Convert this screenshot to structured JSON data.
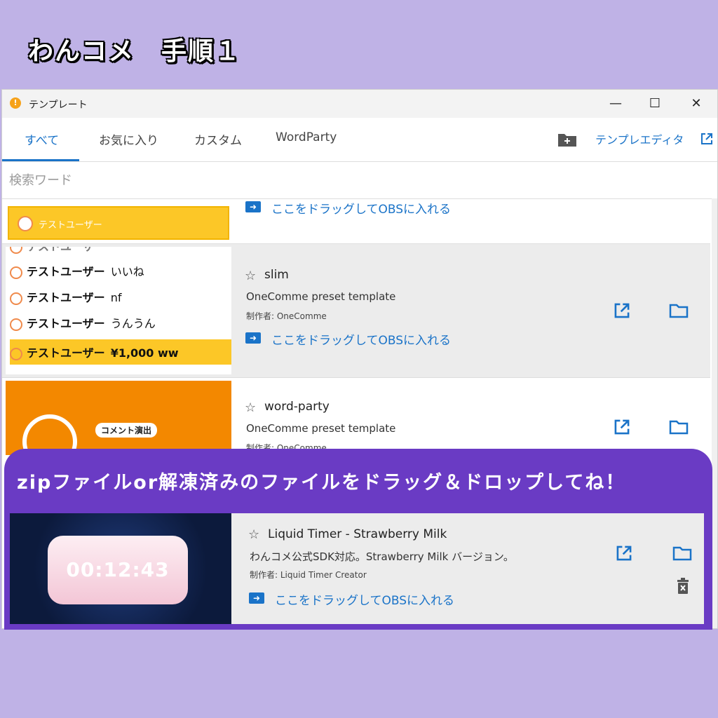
{
  "page_heading": "わんコメ　手順１",
  "window": {
    "title": "テンプレート",
    "controls": {
      "minimize": "—",
      "maximize": "☐",
      "close": "✕"
    }
  },
  "tabs": [
    {
      "label": "すべて",
      "active": true
    },
    {
      "label": "お気に入り"
    },
    {
      "label": "カスタム"
    },
    {
      "label": "WordParty"
    }
  ],
  "toolbar": {
    "editor_label": "テンプレエディタ"
  },
  "search": {
    "placeholder": "検索ワード"
  },
  "drag_label": "ここをドラッグしてOBSに入れる",
  "partial_row": {
    "chat_user": "テストユーザー"
  },
  "slim_preview": {
    "lines": [
      {
        "user": "テストユーザー",
        "msg": "いいね"
      },
      {
        "user": "テストユーザー",
        "msg": "nf"
      },
      {
        "user": "テストユーザー",
        "msg": "うんうん"
      },
      {
        "user": "テストユーザー",
        "msg": "¥1,000 ww",
        "highlight": true
      }
    ]
  },
  "templates": [
    {
      "name": "slim",
      "description": "OneComme preset template",
      "author": "制作者: OneComme"
    },
    {
      "name": "word-party",
      "description": "OneComme preset template",
      "author": "制作者: OneComme",
      "thumb_label": "コメント演出"
    },
    {
      "name": "Liquid Timer - Strawberry Milk",
      "description": "わんコメ公式SDK対応。Strawberry Milk バージョン。",
      "author": "制作者: Liquid Timer Creator",
      "thumb_time": "00:12:43"
    }
  ],
  "banner": {
    "text": "zipファイルor解凍済みのファイルをドラッグ＆ドロップしてね！"
  },
  "colors": {
    "accent": "#1a73c8",
    "banner": "#6a3bc4",
    "background": "#bfb2e6",
    "highlight": "#fcc727"
  }
}
